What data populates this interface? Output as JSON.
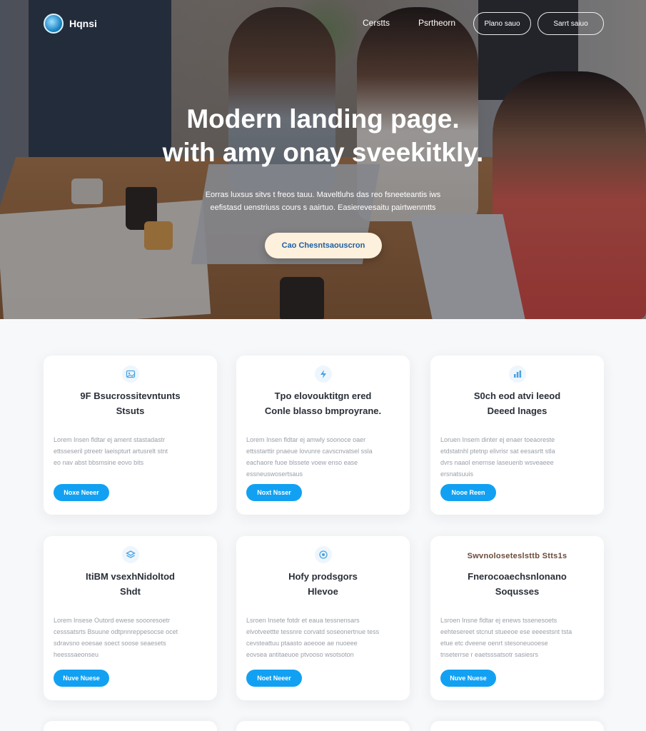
{
  "header": {
    "logo_text": "Hqnsi",
    "nav_links": [
      "Cerstts",
      "Psrtheorn"
    ],
    "nav_buttons": [
      "Plano sauo",
      "Sarrt saiuo"
    ]
  },
  "hero": {
    "title_line1": "Modern landing page.",
    "title_line2": "with amy onay sveekitkly.",
    "subtitle_line1": "Eorras luxsus sitvs t freos tauu. Maveltluhs das reo fsneeteantis iws",
    "subtitle_line2": "eefistasd uenstriuss cours s aairtuo. Easierevesaitu pairtwenmtts",
    "cta_label": "Cao Chesntsaouscron"
  },
  "cards": [
    {
      "icon": "gallery-icon",
      "title_line1": "9F Bsucrossitevntunts",
      "title_line2": "Stsuts",
      "text": [
        "Lorem Insen fldtar ej ament stastadastr",
        "ettsseseril ptreetr laeispturt artusrelt stnt",
        "eo nav abst bbsmsine eovo bits"
      ],
      "button": "Noxe Neeer"
    },
    {
      "icon": "bolt-icon",
      "title_line1": "Tpo elovouktitgn ered",
      "title_line2": "Conle blasso bmproyrane.",
      "text": [
        "Lorem Insen fldtar ej amwly soonoce oaer",
        "ettsstarttir pnaeue lovunre cavscnvatsel ssla",
        "eachaore fuoe blssete voew enso ease",
        "essneuswosertsaus"
      ],
      "button": "Noxt Nsser"
    },
    {
      "icon": "chart-icon",
      "title_line1": "S0ch eod atvi leeod",
      "title_line2": "Deeed lnages",
      "text": [
        "Loruen Insem dinter ej enaer toeaoreste",
        "etdstatnhl ptetnp elivrisr sat eesasrtt stla",
        "dvrs naaol enernse laseuenb wsveaeee",
        "ersnatsuuis"
      ],
      "button": "Nooe Reen"
    },
    {
      "icon": "layers-icon",
      "title_line1": "ItiBM vsexhNidoltod",
      "title_line2": "Shdt",
      "text": [
        "Lorem Insese Outord ewese soooresoetr",
        "cesssatsrts Bsuune odtpnnreppesocse ocet",
        "sdravsno eoesae soect soose seaesets",
        "heesssaeonseu"
      ],
      "button": "Nuve Nuese"
    },
    {
      "icon": "target-icon",
      "title_line1": "Hofy prodsgors",
      "title_line2": "Hlevoe",
      "text": [
        "Lsroen Insete fotdr et eaua tessnensars",
        "elvotveettte tessnre corvatd soseonertnue tess",
        "cevsteattuu ptaasto aoeooe ae nuoeee",
        "eovsea antitaeuoe ptvooso wsotsoton"
      ],
      "button": "Noet Neeer"
    },
    {
      "icon": "",
      "badge": "Swvnoloseteslsttb Stts1s",
      "title_line1": "Fnerocoaechsnlonano",
      "title_line2": "Soqusses",
      "text": [
        "Lsroen Insne fldtar ej enews tssenesoets",
        "eehtesereet stcnut stueeoe ese eeeestsnt tsta",
        "etue etc dveene oenrt stesoneuooese",
        "tnseterrse r eaetsssatsotr sasiesrs"
      ],
      "button": "Nuve Nuese"
    }
  ]
}
